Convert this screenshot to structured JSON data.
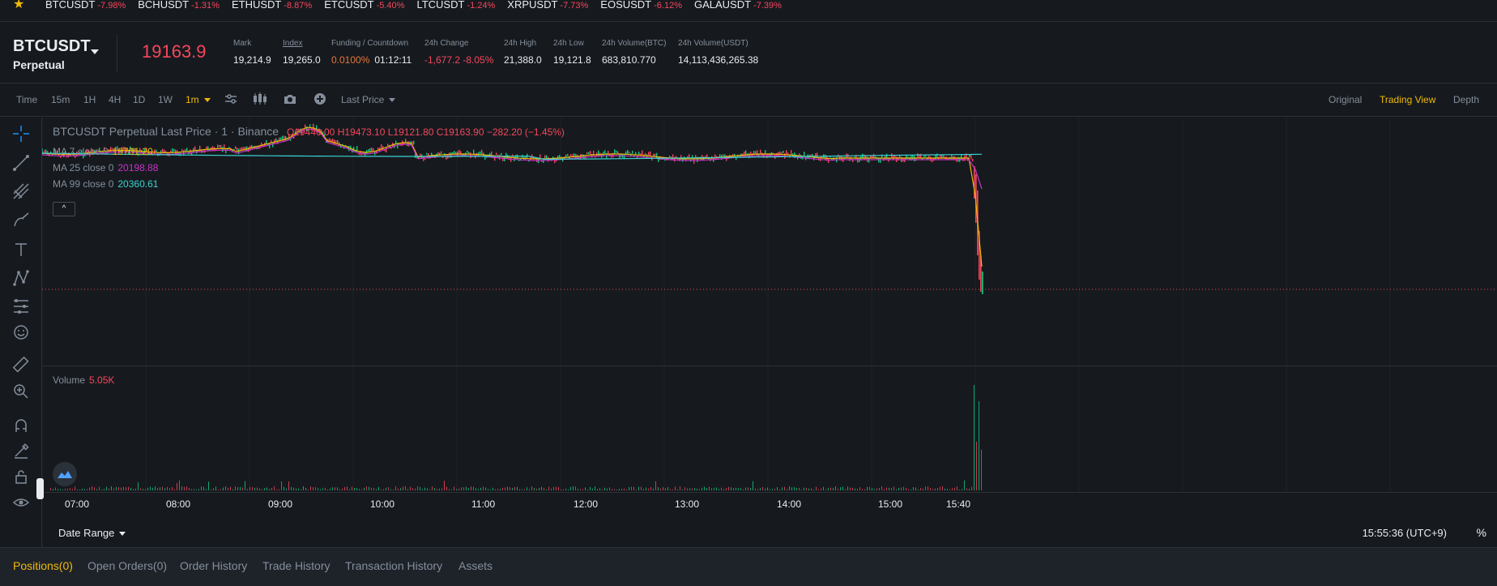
{
  "ticker": [
    {
      "symbol": "BTCUSDT",
      "change": "-7.98%"
    },
    {
      "symbol": "BCHUSDT",
      "change": "-1.31%"
    },
    {
      "symbol": "ETHUSDT",
      "change": "-8.87%"
    },
    {
      "symbol": "ETCUSDT",
      "change": "-5.40%"
    },
    {
      "symbol": "LTCUSDT",
      "change": "-1.24%"
    },
    {
      "symbol": "XRPUSDT",
      "change": "-7.73%"
    },
    {
      "symbol": "EOSUSDT",
      "change": "-6.12%"
    },
    {
      "symbol": "GALAUSDT",
      "change": "-7.39%"
    }
  ],
  "header": {
    "symbol": "BTCUSDT",
    "contract": "Perpetual",
    "last_price": "19163.9",
    "stats": {
      "mark_label": "Mark",
      "mark_value": "19,214.9",
      "index_label": "Index",
      "index_value": "19,265.0",
      "funding_label": "Funding / Countdown",
      "funding_rate": "0.0100%",
      "countdown": "01:12:11",
      "change_label": "24h Change",
      "change_value": "-1,677.2 -8.05%",
      "high_label": "24h High",
      "high_value": "21,388.0",
      "low_label": "24h Low",
      "low_value": "19,121.8",
      "vol_btc_label": "24h Volume(BTC)",
      "vol_btc_value": "683,810.770",
      "vol_usdt_label": "24h Volume(USDT)",
      "vol_usdt_value": "14,113,436,265.38"
    }
  },
  "toolbar": {
    "intervals": [
      "Time",
      "15m",
      "1H",
      "4H",
      "1D",
      "1W"
    ],
    "active_interval": "1m",
    "price_type": "Last Price",
    "views": {
      "original": "Original",
      "trading_view": "Trading View",
      "depth": "Depth"
    }
  },
  "chart": {
    "title": "BTCUSDT Perpetual Last Price · 1 · Binance",
    "ohlc": "O19446.00  H19473.10  L19121.80  C19163.90  −282.20 (−1.45%)",
    "ma7_label": "MA 7 close 0",
    "ma7_value": "19701.20",
    "ma25_label": "MA 25 close 0",
    "ma25_value": "20198.88",
    "ma99_label": "MA 99 close 0",
    "ma99_value": "20360.61",
    "collapse": "^",
    "volume_label": "Volume",
    "volume_value": "5.05K",
    "time_labels": [
      "07:00",
      "08:00",
      "09:00",
      "10:00",
      "11:00",
      "12:00",
      "13:00",
      "14:00",
      "15:00",
      "15:40"
    ],
    "colors": {
      "up": "#0ecb81",
      "down": "#f6465d",
      "ma7": "#f0b90b",
      "ma25": "#c832c8",
      "ma99": "#39d3d3"
    }
  },
  "footer": {
    "date_range": "Date Range",
    "clock": "15:55:36 (UTC+9)",
    "percent": "%"
  },
  "bottom_tabs": {
    "positions": "Positions(0)",
    "open_orders": "Open Orders(0)",
    "order_history": "Order History",
    "trade_history": "Trade History",
    "transaction_history": "Transaction History",
    "assets": "Assets"
  }
}
